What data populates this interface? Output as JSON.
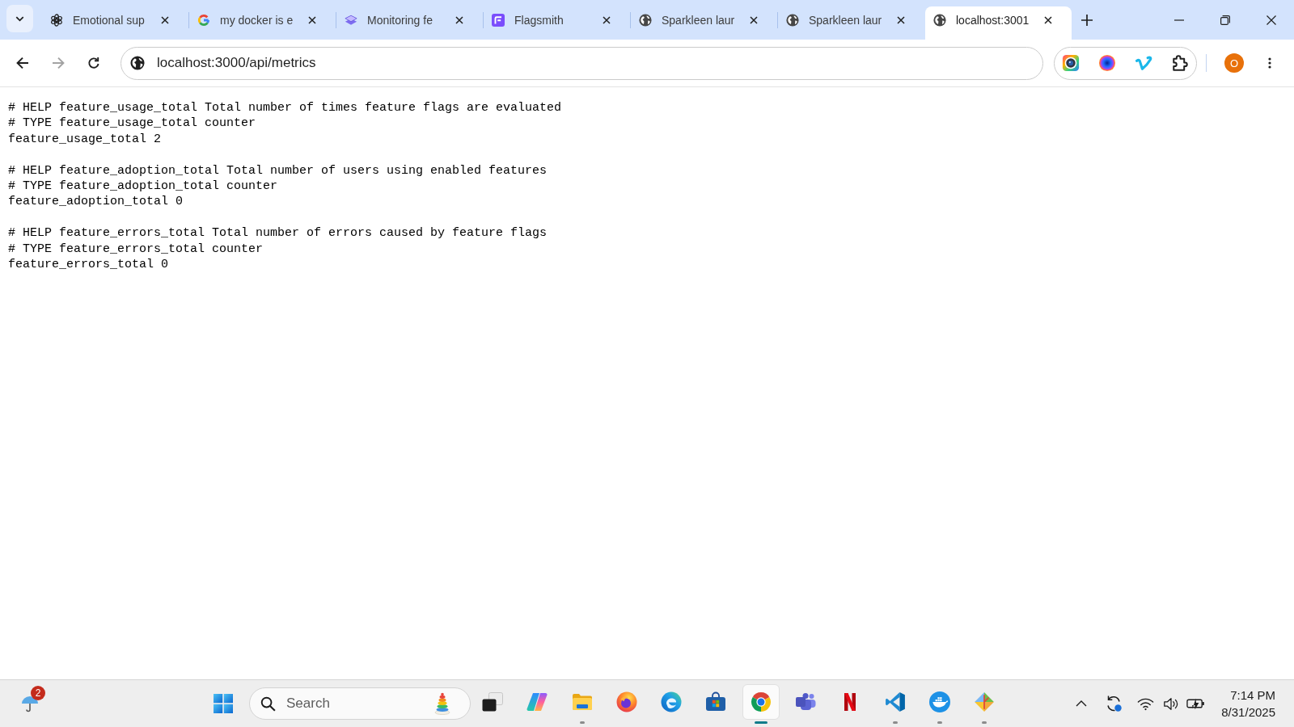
{
  "browser": {
    "tabs": [
      {
        "title": "Emotional sup",
        "selected": false
      },
      {
        "title": "my docker is e",
        "selected": false
      },
      {
        "title": "Monitoring fe",
        "selected": false
      },
      {
        "title": "Flagsmith",
        "selected": false
      },
      {
        "title": "Sparkleen laur",
        "selected": false
      },
      {
        "title": "Sparkleen laur",
        "selected": false
      },
      {
        "title": "localhost:3001",
        "selected": true
      }
    ],
    "navigation": {
      "back_disabled": false,
      "forward_disabled": true
    },
    "address_bar": {
      "url": "localhost:3000/api/metrics"
    },
    "profile": {
      "initial": "O"
    }
  },
  "page": {
    "metric_blocks": [
      {
        "lines": [
          "# HELP feature_usage_total Total number of times feature flags are evaluated",
          "# TYPE feature_usage_total counter",
          "feature_usage_total 2"
        ]
      },
      {
        "lines": [
          "# HELP feature_adoption_total Total number of users using enabled features",
          "# TYPE feature_adoption_total counter",
          "feature_adoption_total 0"
        ]
      },
      {
        "lines": [
          "# HELP feature_errors_total Total number of errors caused by feature flags",
          "# TYPE feature_errors_total counter",
          "feature_errors_total 0"
        ]
      }
    ]
  },
  "taskbar": {
    "weather": {
      "badge": "2"
    },
    "search": {
      "placeholder": "Search"
    },
    "apps": [
      {
        "running": false,
        "selected": false
      },
      {
        "running": false,
        "selected": false
      },
      {
        "running": true,
        "selected": false
      },
      {
        "running": false,
        "selected": false
      },
      {
        "running": false,
        "selected": false
      },
      {
        "running": false,
        "selected": false
      },
      {
        "running": true,
        "selected": true
      },
      {
        "running": false,
        "selected": false
      },
      {
        "running": false,
        "selected": false
      },
      {
        "running": true,
        "selected": false
      },
      {
        "running": true,
        "selected": false
      },
      {
        "running": true,
        "selected": false
      }
    ],
    "clock": {
      "time": "7:14 PM",
      "date": "8/31/2025"
    }
  }
}
